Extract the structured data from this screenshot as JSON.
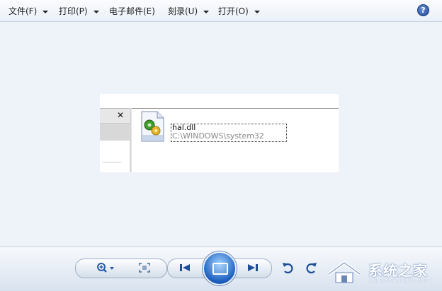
{
  "menu": {
    "items": [
      {
        "label": "文件(F)"
      },
      {
        "label": "打印(P)"
      },
      {
        "label": "电子邮件(E)"
      },
      {
        "label": "刻录(U)"
      },
      {
        "label": "打开(O)"
      }
    ],
    "help_symbol": "?"
  },
  "photo": {
    "file_name": "hal.dll",
    "file_path": "C:\\WINDOWS\\system32",
    "close_symbol": "✕"
  },
  "controls": {
    "zoom_icon": "zoom-icon",
    "fit_icon": "fit-window-icon",
    "prev_icon": "previous-icon",
    "slideshow_icon": "slideshow-icon",
    "next_icon": "next-icon",
    "rotate_ccw_icon": "rotate-counterclockwise-icon",
    "rotate_cw_icon": "rotate-clockwise-icon"
  },
  "watermark": {
    "title": "系统之家",
    "subtitle": "XITONGZHIJIA.NET"
  },
  "colors": {
    "accent": "#1b5fbf",
    "viewer_bg": "#eef2f9"
  }
}
